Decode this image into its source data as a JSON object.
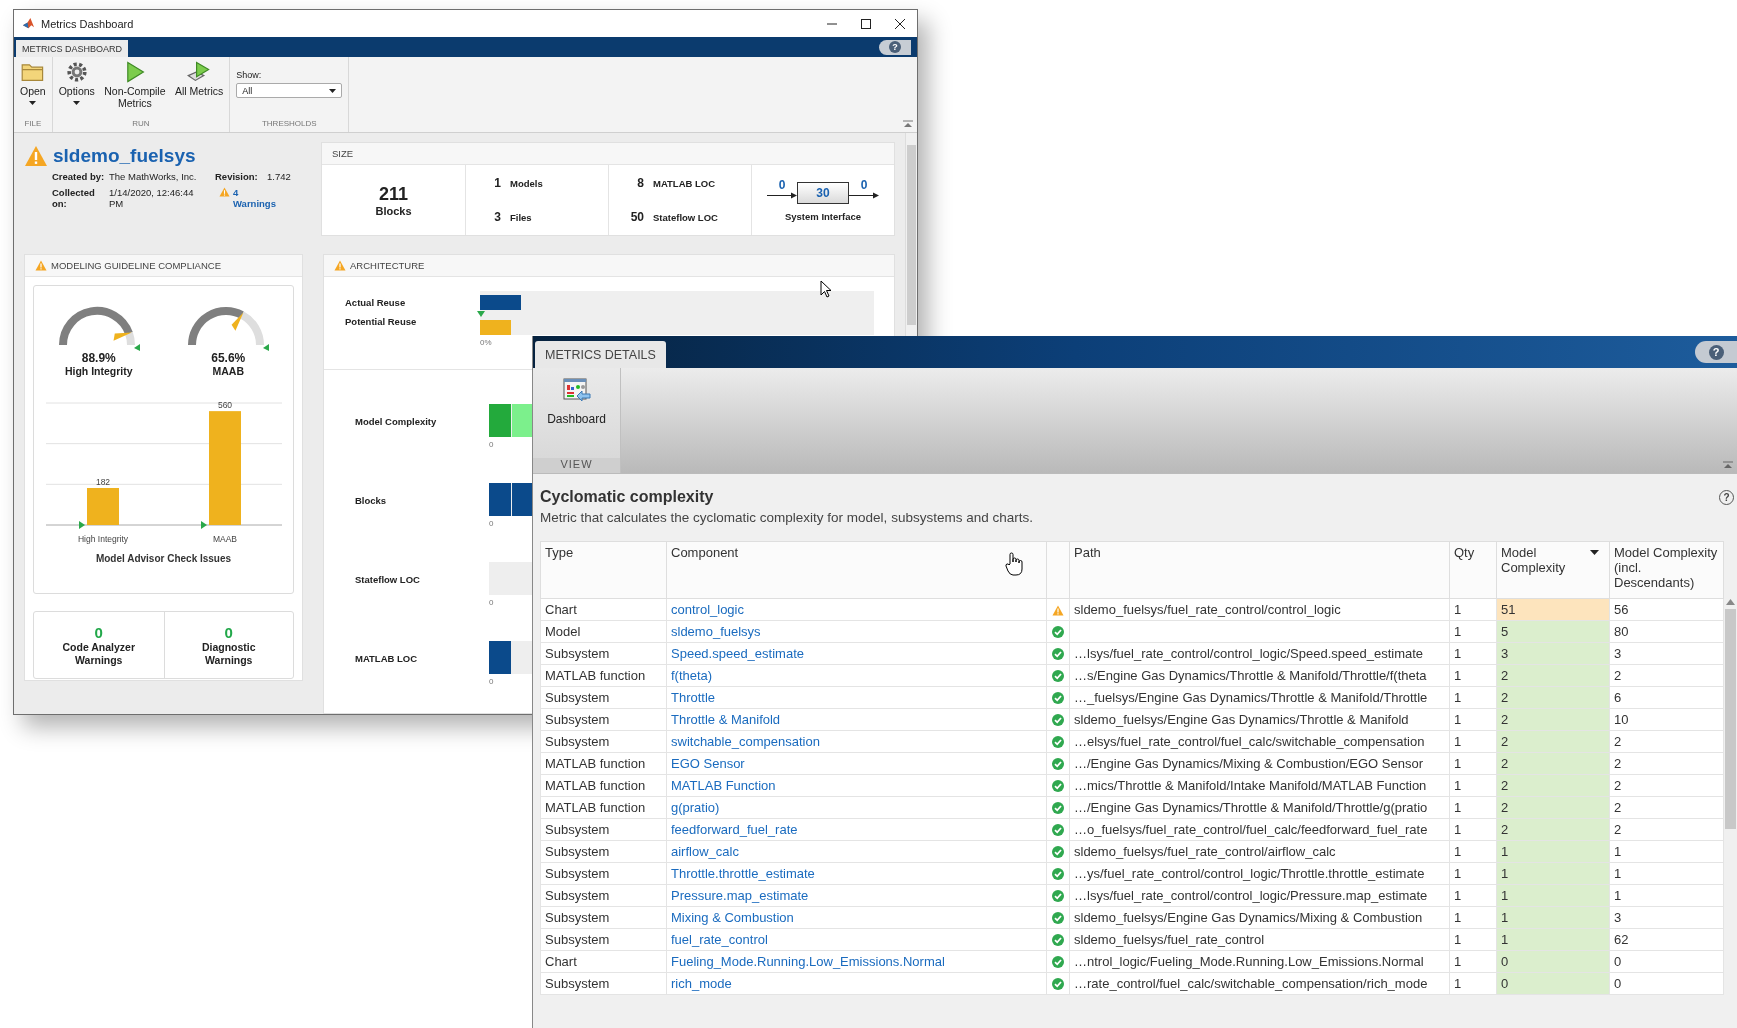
{
  "dashboard_window": {
    "title": "Metrics Dashboard",
    "help": "?",
    "tabs": [
      {
        "label": "METRICS DASHBOARD",
        "selected": true
      }
    ],
    "sections": [
      {
        "label": "FILE",
        "kind": "buttons",
        "buttons": [
          {
            "label": "Open",
            "kind": "folder",
            "menu": true
          }
        ]
      },
      {
        "label": "RUN",
        "kind": "buttons",
        "buttons": [
          {
            "label": "Options",
            "kind": "gear",
            "menu": true
          },
          {
            "label": "Non-Compile Metrics",
            "kind": "play",
            "menu": false
          },
          {
            "label": "All Metrics",
            "kind": "play-all",
            "menu": false
          }
        ]
      },
      {
        "label": "THRESHOLDS",
        "kind": "filter",
        "filter_label": "Show:",
        "filter_value": "All"
      }
    ],
    "model": {
      "name": "sldemo_fuelsys",
      "warning": true,
      "created_by_label": "Created by:",
      "created_by": "The MathWorks, Inc.",
      "revision_label": "Revision:",
      "revision": "1.742",
      "collected_label": "Collected on:",
      "collected": "1/14/2020, 12:46:44 PM",
      "warnings_link": "4 Warnings"
    },
    "size": {
      "title": "SIZE",
      "blocks_value": "211",
      "blocks_label": "Blocks",
      "stats": [
        {
          "value": "1",
          "label": "Models"
        },
        {
          "value": "8",
          "label": "MATLAB LOC"
        },
        {
          "value": "3",
          "label": "Files"
        },
        {
          "value": "50",
          "label": "Stateflow LOC"
        }
      ],
      "interface": {
        "inputs": "0",
        "value": "30",
        "outputs": "0",
        "label": "System Interface"
      }
    },
    "compliance": {
      "title": "MODELING GUIDELINE COMPLIANCE",
      "warning": true,
      "gauges": [
        {
          "value": "88.9%",
          "label": "High Integrity"
        },
        {
          "value": "65.6%",
          "label": "MAAB"
        }
      ],
      "chart_data": {
        "type": "bar",
        "title": "Model Advisor Check Issues",
        "categories": [
          "High Integrity",
          "MAAB"
        ],
        "values": [
          182,
          560
        ],
        "data_labels": true
      },
      "counts": [
        {
          "value": "0",
          "label": "Code Analyzer Warnings"
        },
        {
          "value": "0",
          "label": "Diagnostic Warnings"
        }
      ]
    },
    "architecture": {
      "title": "ARCHITECTURE",
      "warning": true,
      "reuse_axis": "0%",
      "reuse": [
        {
          "label": "Actual Reuse",
          "level": 0.103,
          "color": "#0b4a8b"
        },
        {
          "label": "Potential Reuse",
          "level": 0.078,
          "color": "#efb21e"
        }
      ],
      "metrics": [
        {
          "label": "Model Complexity",
          "axis": "0",
          "segments": [
            {
              "color": "#23aa3c"
            },
            {
              "color": "#7cf08c"
            }
          ]
        },
        {
          "label": "Blocks",
          "axis": "0",
          "segments": [
            {
              "color": "#0b4a8b"
            },
            {
              "color": "#0b4a8b"
            }
          ]
        },
        {
          "label": "Stateflow LOC",
          "axis": "0"
        },
        {
          "label": "MATLAB LOC",
          "axis": "0",
          "segments": [
            {
              "color": "#0b4a8b"
            }
          ]
        }
      ]
    }
  },
  "details_window": {
    "help": "?",
    "tabs": [
      {
        "label": "METRICS DETAILS",
        "selected": true
      }
    ],
    "toolstrip": {
      "button": "Dashboard",
      "section": "VIEW"
    },
    "title": "Cyclomatic complexity",
    "description": "Metric that calculates the cyclomatic complexity for model, subsystems and charts.",
    "content_help": "?",
    "table": {
      "columns": [
        {
          "label": "Type",
          "sorted": false
        },
        {
          "label": "Component",
          "sorted": false
        },
        {
          "label": "Path",
          "sorted": false
        },
        {
          "label": "Qty",
          "sorted": false
        },
        {
          "label": "Model Complexity",
          "sorted": true
        },
        {
          "label": "Model Complexity (incl. Descendants)",
          "sorted": false
        }
      ],
      "rows": [
        {
          "type": "Chart",
          "component": "control_logic",
          "warning": true,
          "path": "sldemo_fuelsys/fuel_rate_control/control_logic",
          "qty": "1",
          "complexity": "51",
          "complexity_incl": "56"
        },
        {
          "type": "Model",
          "component": "sldemo_fuelsys",
          "warning": false,
          "qty": "1",
          "complexity": "5",
          "complexity_incl": "80"
        },
        {
          "type": "Subsystem",
          "component": "Speed.speed_estimate",
          "warning": false,
          "path": "…lsys/fuel_rate_control/control_logic/Speed.speed_estimate",
          "qty": "1",
          "complexity": "3",
          "complexity_incl": "3"
        },
        {
          "type": "MATLAB function",
          "component": "f(theta)",
          "warning": false,
          "path": "…s/Engine Gas Dynamics/Throttle & Manifold/Throttle/f(theta",
          "qty": "1",
          "complexity": "2",
          "complexity_incl": "2"
        },
        {
          "type": "Subsystem",
          "component": "Throttle",
          "warning": false,
          "path": "…_fuelsys/Engine Gas Dynamics/Throttle & Manifold/Throttle",
          "qty": "1",
          "complexity": "2",
          "complexity_incl": "6"
        },
        {
          "type": "Subsystem",
          "component": "Throttle & Manifold",
          "warning": false,
          "path": "sldemo_fuelsys/Engine Gas Dynamics/Throttle & Manifold",
          "qty": "1",
          "complexity": "2",
          "complexity_incl": "10"
        },
        {
          "type": "Subsystem",
          "component": "switchable_compensation",
          "warning": false,
          "path": "…elsys/fuel_rate_control/fuel_calc/switchable_compensation",
          "qty": "1",
          "complexity": "2",
          "complexity_incl": "2"
        },
        {
          "type": "MATLAB function",
          "component": "EGO Sensor",
          "warning": false,
          "path": "…/Engine Gas Dynamics/Mixing & Combustion/EGO Sensor",
          "qty": "1",
          "complexity": "2",
          "complexity_incl": "2"
        },
        {
          "type": "MATLAB function",
          "component": "MATLAB Function",
          "warning": false,
          "path": "…mics/Throttle & Manifold/Intake Manifold/MATLAB Function",
          "qty": "1",
          "complexity": "2",
          "complexity_incl": "2"
        },
        {
          "type": "MATLAB function",
          "component": "g(pratio)",
          "warning": false,
          "path": "…/Engine Gas Dynamics/Throttle & Manifold/Throttle/g(pratio",
          "qty": "1",
          "complexity": "2",
          "complexity_incl": "2"
        },
        {
          "type": "Subsystem",
          "component": "feedforward_fuel_rate",
          "warning": false,
          "path": "…o_fuelsys/fuel_rate_control/fuel_calc/feedforward_fuel_rate",
          "qty": "1",
          "complexity": "2",
          "complexity_incl": "2"
        },
        {
          "type": "Subsystem",
          "component": "airflow_calc",
          "warning": false,
          "path": "sldemo_fuelsys/fuel_rate_control/airflow_calc",
          "qty": "1",
          "complexity": "1",
          "complexity_incl": "1"
        },
        {
          "type": "Subsystem",
          "component": "Throttle.throttle_estimate",
          "warning": false,
          "path": "…ys/fuel_rate_control/control_logic/Throttle.throttle_estimate",
          "qty": "1",
          "complexity": "1",
          "complexity_incl": "1"
        },
        {
          "type": "Subsystem",
          "component": "Pressure.map_estimate",
          "warning": false,
          "path": "…lsys/fuel_rate_control/control_logic/Pressure.map_estimate",
          "qty": "1",
          "complexity": "1",
          "complexity_incl": "1"
        },
        {
          "type": "Subsystem",
          "component": "Mixing & Combustion",
          "warning": false,
          "path": "sldemo_fuelsys/Engine Gas Dynamics/Mixing & Combustion",
          "qty": "1",
          "complexity": "1",
          "complexity_incl": "3"
        },
        {
          "type": "Subsystem",
          "component": "fuel_rate_control",
          "warning": false,
          "path": "sldemo_fuelsys/fuel_rate_control",
          "qty": "1",
          "complexity": "1",
          "complexity_incl": "62"
        },
        {
          "type": "Chart",
          "component": "Fueling_Mode.Running.Low_Emissions.Normal",
          "warning": false,
          "path": "…ntrol_logic/Fueling_Mode.Running.Low_Emissions.Normal",
          "qty": "1",
          "complexity": "0",
          "complexity_incl": "0"
        },
        {
          "type": "Subsystem",
          "component": "rich_mode",
          "warning": false,
          "path": "…rate_control/fuel_calc/switchable_compensation/rich_mode",
          "qty": "1",
          "complexity": "0",
          "complexity_incl": "0"
        }
      ]
    }
  }
}
